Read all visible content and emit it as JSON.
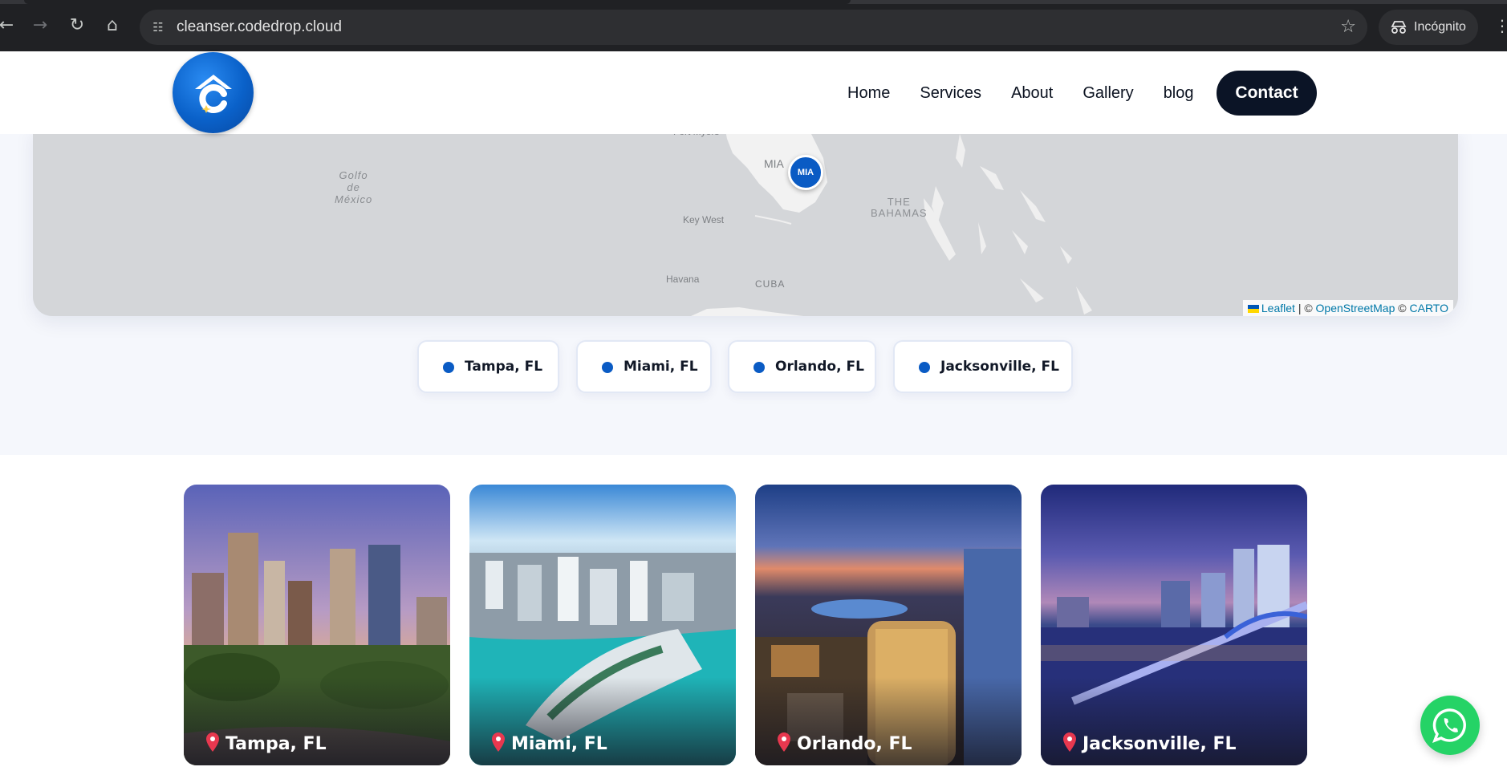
{
  "browser": {
    "url": "cleanser.codedrop.cloud",
    "incognito_label": "Incógnito",
    "icons": [
      "back-icon",
      "forward-icon",
      "reload-icon",
      "home-icon",
      "site-info-icon",
      "bookmark-star-icon",
      "incognito-icon",
      "menu-icon"
    ]
  },
  "header": {
    "nav": [
      "Home",
      "Services",
      "About",
      "Gallery",
      "blog"
    ],
    "contact_label": "Contact"
  },
  "map": {
    "labels": {
      "gulf": "Golfo\nde\nMéxico",
      "fort_myers": "Fort Myers",
      "mia": "MIA",
      "key_west": "Key West",
      "bahamas": "THE\nBAHAMAS",
      "havana": "Havana",
      "cuba": "CUBA"
    },
    "marker_label": "MIA",
    "attribution": {
      "leaflet": "Leaflet",
      "separator": "| ©",
      "osm": "OpenStreetMap",
      "copy": "©",
      "carto": "CARTO"
    }
  },
  "locations": [
    "Tampa, FL",
    "Miami, FL",
    "Orlando, FL",
    "Jacksonville, FL"
  ],
  "colors": {
    "accent": "#0a5bc4",
    "nav_dark": "#0b1426",
    "section_bg": "#f5f7fc",
    "whatsapp": "#25d366"
  }
}
